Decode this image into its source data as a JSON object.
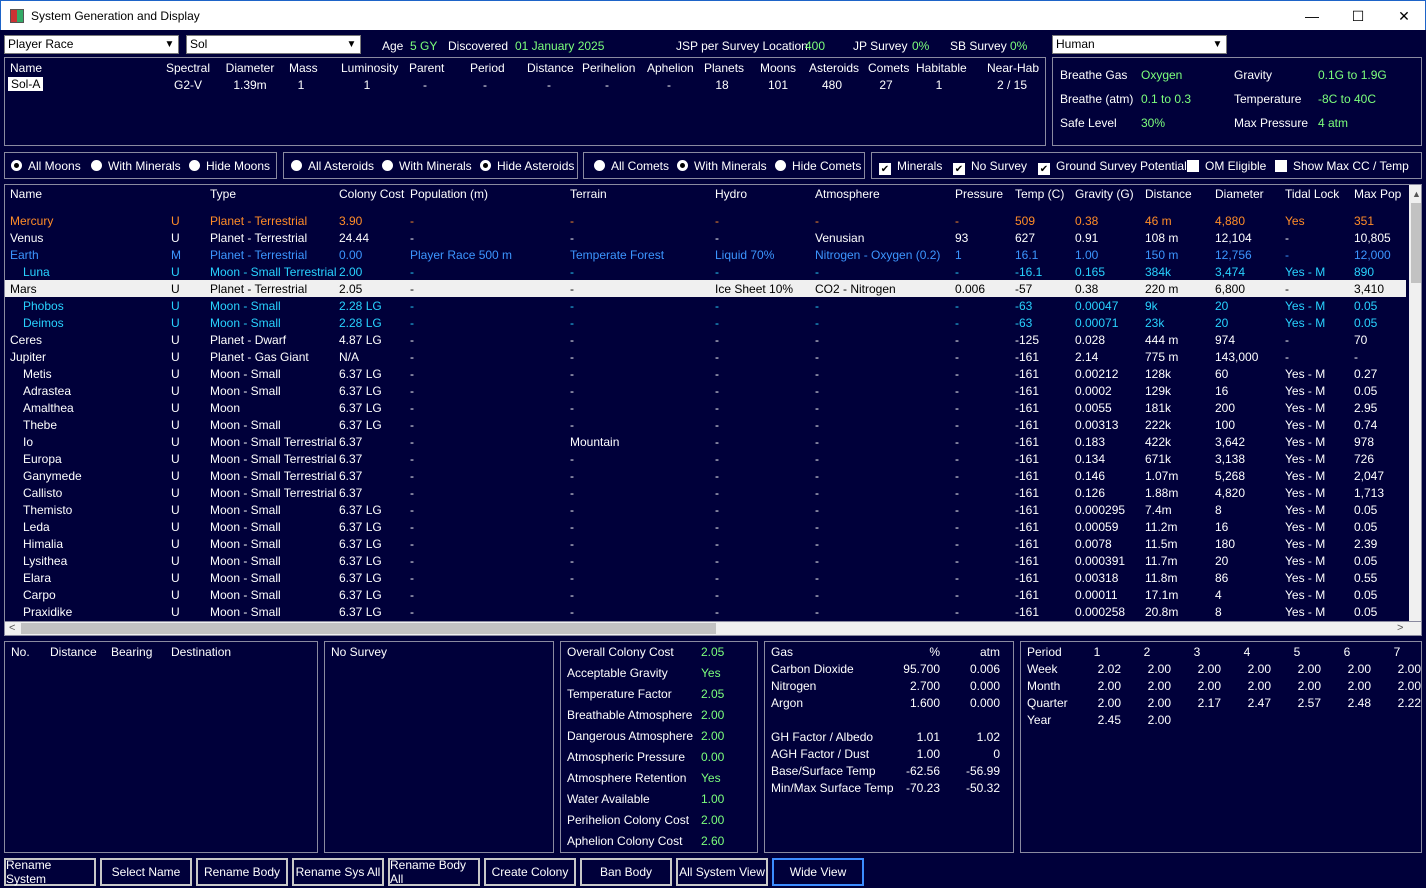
{
  "window": {
    "title": "System Generation and Display",
    "min": "—",
    "max": "☐",
    "close": "✕"
  },
  "top": {
    "race_select": "Player Race",
    "system_select": "Sol",
    "age_label": "Age",
    "age_value": "5 GY",
    "discovered_label": "Discovered",
    "discovered_value": "01 January 2025",
    "jsp_label": "JSP per Survey Location",
    "jsp_value": "400",
    "jp_label": "JP Survey",
    "jp_value": "0%",
    "sb_label": "SB Survey",
    "sb_value": "0%",
    "species_select": "Human"
  },
  "star_headers": [
    "Name",
    "Spectral",
    "Diameter",
    "Mass",
    "Luminosity",
    "Parent",
    "Period",
    "Distance",
    "Perihelion",
    "Aphelion",
    "Planets",
    "Moons",
    "Asteroids",
    "Comets",
    "Habitable",
    "Near-Hab"
  ],
  "star_row": [
    "Sol-A",
    "G2-V",
    "1.39m",
    "1",
    "1",
    "-",
    "-",
    "-",
    "-",
    "-",
    "18",
    "101",
    "480",
    "27",
    "1",
    "2 / 15"
  ],
  "env": {
    "breathe_gas_label": "Breathe Gas",
    "breathe_gas": "Oxygen",
    "gravity_label": "Gravity",
    "gravity": "0.1G  to  1.9G",
    "breathe_atm_label": "Breathe (atm)",
    "breathe_atm": "0.1  to  0.3",
    "temperature_label": "Temperature",
    "temperature": "-8C  to  40C",
    "safe_label": "Safe Level",
    "safe": "30%",
    "maxp_label": "Max Pressure",
    "maxp": "4 atm"
  },
  "filters": {
    "moons": [
      "All Moons",
      "With Minerals",
      "Hide Moons"
    ],
    "asteroids": [
      "All Asteroids",
      "With Minerals",
      "Hide Asteroids"
    ],
    "comets": [
      "All Comets",
      "With Minerals",
      "Hide Comets"
    ],
    "checks": [
      "Minerals",
      "No Survey",
      "Ground Survey Potential",
      "OM Eligible",
      "Show Max CC / Temp"
    ]
  },
  "colors": {
    "orange": "#ff8c28",
    "blue": "#3c96ff",
    "cyan": "#28d2ff",
    "white": "#ffffff"
  },
  "grid_headers": [
    "Name",
    "Type",
    "Colony Cost",
    "Population (m)",
    "Terrain",
    "Hydro",
    "Atmosphere",
    "Pressure",
    "Temp (C)",
    "Gravity (G)",
    "Distance",
    "Diameter",
    "Tidal Lock",
    "Max Pop"
  ],
  "grid_rows": [
    {
      "c": "orange",
      "i": 0,
      "v": [
        "Mercury",
        "U",
        "Planet - Terrestrial",
        "3.90",
        "-",
        "-",
        "-",
        "-",
        "-",
        "509",
        "0.38",
        "46 m",
        "4,880",
        "Yes",
        "351"
      ]
    },
    {
      "c": "white",
      "i": 0,
      "v": [
        "Venus",
        "U",
        "Planet - Terrestrial",
        "24.44",
        "-",
        "-",
        "-",
        "Venusian",
        "93",
        "627",
        "0.91",
        "108 m",
        "12,104",
        "-",
        "10,805"
      ]
    },
    {
      "c": "blue",
      "i": 0,
      "v": [
        "Earth",
        "M",
        "Planet - Terrestrial",
        "0.00",
        "Player Race 500 m",
        "Temperate Forest",
        "Liquid 70%",
        "Nitrogen - Oxygen (0.2)",
        "1",
        "16.1",
        "1.00",
        "150 m",
        "12,756",
        "-",
        "12,000"
      ]
    },
    {
      "c": "cyan",
      "i": 1,
      "v": [
        "Luna",
        "U",
        "Moon - Small Terrestrial",
        "2.00",
        "-",
        "-",
        "-",
        "-",
        "-",
        "-16.1",
        "0.165",
        "384k",
        "3,474",
        "Yes - M",
        "890"
      ]
    },
    {
      "c": "white",
      "i": 0,
      "sel": true,
      "v": [
        "Mars",
        "U",
        "Planet - Terrestrial",
        "2.05",
        "-",
        "-",
        "Ice Sheet 10%",
        "CO2 - Nitrogen",
        "0.006",
        "-57",
        "0.38",
        "220 m",
        "6,800",
        "-",
        "3,410"
      ]
    },
    {
      "c": "cyan",
      "i": 1,
      "v": [
        "Phobos",
        "U",
        "Moon - Small",
        "2.28 LG",
        "-",
        "-",
        "-",
        "-",
        "-",
        "-63",
        "0.00047",
        "9k",
        "20",
        "Yes - M",
        "0.05"
      ]
    },
    {
      "c": "cyan",
      "i": 1,
      "v": [
        "Deimos",
        "U",
        "Moon - Small",
        "2.28 LG",
        "-",
        "-",
        "-",
        "-",
        "-",
        "-63",
        "0.00071",
        "23k",
        "20",
        "Yes - M",
        "0.05"
      ]
    },
    {
      "c": "white",
      "i": 0,
      "v": [
        "Ceres",
        "U",
        "Planet - Dwarf",
        "4.87 LG",
        "-",
        "-",
        "-",
        "-",
        "-",
        "-125",
        "0.028",
        "444 m",
        "974",
        "-",
        "70"
      ]
    },
    {
      "c": "white",
      "i": 0,
      "v": [
        "Jupiter",
        "U",
        "Planet - Gas Giant",
        "N/A",
        "-",
        "-",
        "-",
        "-",
        "-",
        "-161",
        "2.14",
        "775 m",
        "143,000",
        "-",
        "-"
      ]
    },
    {
      "c": "white",
      "i": 1,
      "v": [
        "Metis",
        "U",
        "Moon - Small",
        "6.37 LG",
        "-",
        "-",
        "-",
        "-",
        "-",
        "-161",
        "0.00212",
        "128k",
        "60",
        "Yes - M",
        "0.27"
      ]
    },
    {
      "c": "white",
      "i": 1,
      "v": [
        "Adrastea",
        "U",
        "Moon - Small",
        "6.37 LG",
        "-",
        "-",
        "-",
        "-",
        "-",
        "-161",
        "0.0002",
        "129k",
        "16",
        "Yes - M",
        "0.05"
      ]
    },
    {
      "c": "white",
      "i": 1,
      "v": [
        "Amalthea",
        "U",
        "Moon",
        "6.37 LG",
        "-",
        "-",
        "-",
        "-",
        "-",
        "-161",
        "0.0055",
        "181k",
        "200",
        "Yes - M",
        "2.95"
      ]
    },
    {
      "c": "white",
      "i": 1,
      "v": [
        "Thebe",
        "U",
        "Moon - Small",
        "6.37 LG",
        "-",
        "-",
        "-",
        "-",
        "-",
        "-161",
        "0.00313",
        "222k",
        "100",
        "Yes - M",
        "0.74"
      ]
    },
    {
      "c": "white",
      "i": 1,
      "v": [
        "Io",
        "U",
        "Moon - Small Terrestrial",
        "6.37",
        "-",
        "Mountain",
        "-",
        "-",
        "-",
        "-161",
        "0.183",
        "422k",
        "3,642",
        "Yes - M",
        "978"
      ]
    },
    {
      "c": "white",
      "i": 1,
      "v": [
        "Europa",
        "U",
        "Moon - Small Terrestrial",
        "6.37",
        "-",
        "-",
        "-",
        "-",
        "-",
        "-161",
        "0.134",
        "671k",
        "3,138",
        "Yes - M",
        "726"
      ]
    },
    {
      "c": "white",
      "i": 1,
      "v": [
        "Ganymede",
        "U",
        "Moon - Small Terrestrial",
        "6.37",
        "-",
        "-",
        "-",
        "-",
        "-",
        "-161",
        "0.146",
        "1.07m",
        "5,268",
        "Yes - M",
        "2,047"
      ]
    },
    {
      "c": "white",
      "i": 1,
      "v": [
        "Callisto",
        "U",
        "Moon - Small Terrestrial",
        "6.37",
        "-",
        "-",
        "-",
        "-",
        "-",
        "-161",
        "0.126",
        "1.88m",
        "4,820",
        "Yes - M",
        "1,713"
      ]
    },
    {
      "c": "white",
      "i": 1,
      "v": [
        "Themisto",
        "U",
        "Moon - Small",
        "6.37 LG",
        "-",
        "-",
        "-",
        "-",
        "-",
        "-161",
        "0.000295",
        "7.4m",
        "8",
        "Yes - M",
        "0.05"
      ]
    },
    {
      "c": "white",
      "i": 1,
      "v": [
        "Leda",
        "U",
        "Moon - Small",
        "6.37 LG",
        "-",
        "-",
        "-",
        "-",
        "-",
        "-161",
        "0.00059",
        "11.2m",
        "16",
        "Yes - M",
        "0.05"
      ]
    },
    {
      "c": "white",
      "i": 1,
      "v": [
        "Himalia",
        "U",
        "Moon - Small",
        "6.37 LG",
        "-",
        "-",
        "-",
        "-",
        "-",
        "-161",
        "0.0078",
        "11.5m",
        "180",
        "Yes - M",
        "2.39"
      ]
    },
    {
      "c": "white",
      "i": 1,
      "v": [
        "Lysithea",
        "U",
        "Moon - Small",
        "6.37 LG",
        "-",
        "-",
        "-",
        "-",
        "-",
        "-161",
        "0.000391",
        "11.7m",
        "20",
        "Yes - M",
        "0.05"
      ]
    },
    {
      "c": "white",
      "i": 1,
      "v": [
        "Elara",
        "U",
        "Moon - Small",
        "6.37 LG",
        "-",
        "-",
        "-",
        "-",
        "-",
        "-161",
        "0.00318",
        "11.8m",
        "86",
        "Yes - M",
        "0.55"
      ]
    },
    {
      "c": "white",
      "i": 1,
      "v": [
        "Carpo",
        "U",
        "Moon - Small",
        "6.37 LG",
        "-",
        "-",
        "-",
        "-",
        "-",
        "-161",
        "0.00011",
        "17.1m",
        "4",
        "Yes - M",
        "0.05"
      ]
    },
    {
      "c": "white",
      "i": 1,
      "v": [
        "Praxidike",
        "U",
        "Moon - Small",
        "6.37 LG",
        "-",
        "-",
        "-",
        "-",
        "-",
        "-161",
        "0.000258",
        "20.8m",
        "8",
        "Yes - M",
        "0.05"
      ]
    }
  ],
  "jump": {
    "headers": [
      "No.",
      "Distance",
      "Bearing",
      "Destination"
    ]
  },
  "survey": {
    "label": "No Survey"
  },
  "colony": [
    [
      "Overall Colony Cost",
      "2.05"
    ],
    [
      "Acceptable Gravity",
      "Yes"
    ],
    [
      "Temperature Factor",
      "2.05"
    ],
    [
      "Breathable Atmosphere",
      "2.00"
    ],
    [
      "Dangerous Atmosphere",
      "2.00"
    ],
    [
      "Atmospheric Pressure",
      "0.00"
    ],
    [
      "Atmosphere Retention",
      "Yes"
    ],
    [
      "Water Available",
      "1.00"
    ],
    [
      "Perihelion Colony Cost",
      "2.00"
    ],
    [
      "Aphelion Colony Cost",
      "2.60"
    ]
  ],
  "gas": {
    "headers": [
      "Gas",
      "%",
      "atm"
    ],
    "rows": [
      [
        "Carbon Dioxide",
        "95.700",
        "0.006"
      ],
      [
        "Nitrogen",
        "2.700",
        "0.000"
      ],
      [
        "Argon",
        "1.600",
        "0.000"
      ]
    ],
    "factors": [
      [
        "GH Factor / Albedo",
        "1.01",
        "1.02"
      ],
      [
        "AGH Factor / Dust",
        "1.00",
        "0"
      ],
      [
        "Base/Surface Temp",
        "-62.56",
        "-56.99"
      ],
      [
        "Min/Max Surface Temp",
        "-70.23",
        "-50.32"
      ]
    ]
  },
  "period": {
    "headers": [
      "Period",
      "1",
      "2",
      "3",
      "4",
      "5",
      "6",
      "7"
    ],
    "rows": [
      [
        "Week",
        "2.02",
        "2.00",
        "2.00",
        "2.00",
        "2.00",
        "2.00",
        "2.00"
      ],
      [
        "Month",
        "2.00",
        "2.00",
        "2.00",
        "2.00",
        "2.00",
        "2.00",
        "2.00"
      ],
      [
        "Quarter",
        "2.00",
        "2.00",
        "2.17",
        "2.47",
        "2.57",
        "2.48",
        "2.22"
      ],
      [
        "Year",
        "2.45",
        "2.00",
        "",
        "",
        "",
        "",
        ""
      ]
    ]
  },
  "buttons": [
    "Rename System",
    "Select Name",
    "Rename Body",
    "Rename Sys All",
    "Rename Body All",
    "Create Colony",
    "Ban Body",
    "All System View",
    "Wide View"
  ]
}
